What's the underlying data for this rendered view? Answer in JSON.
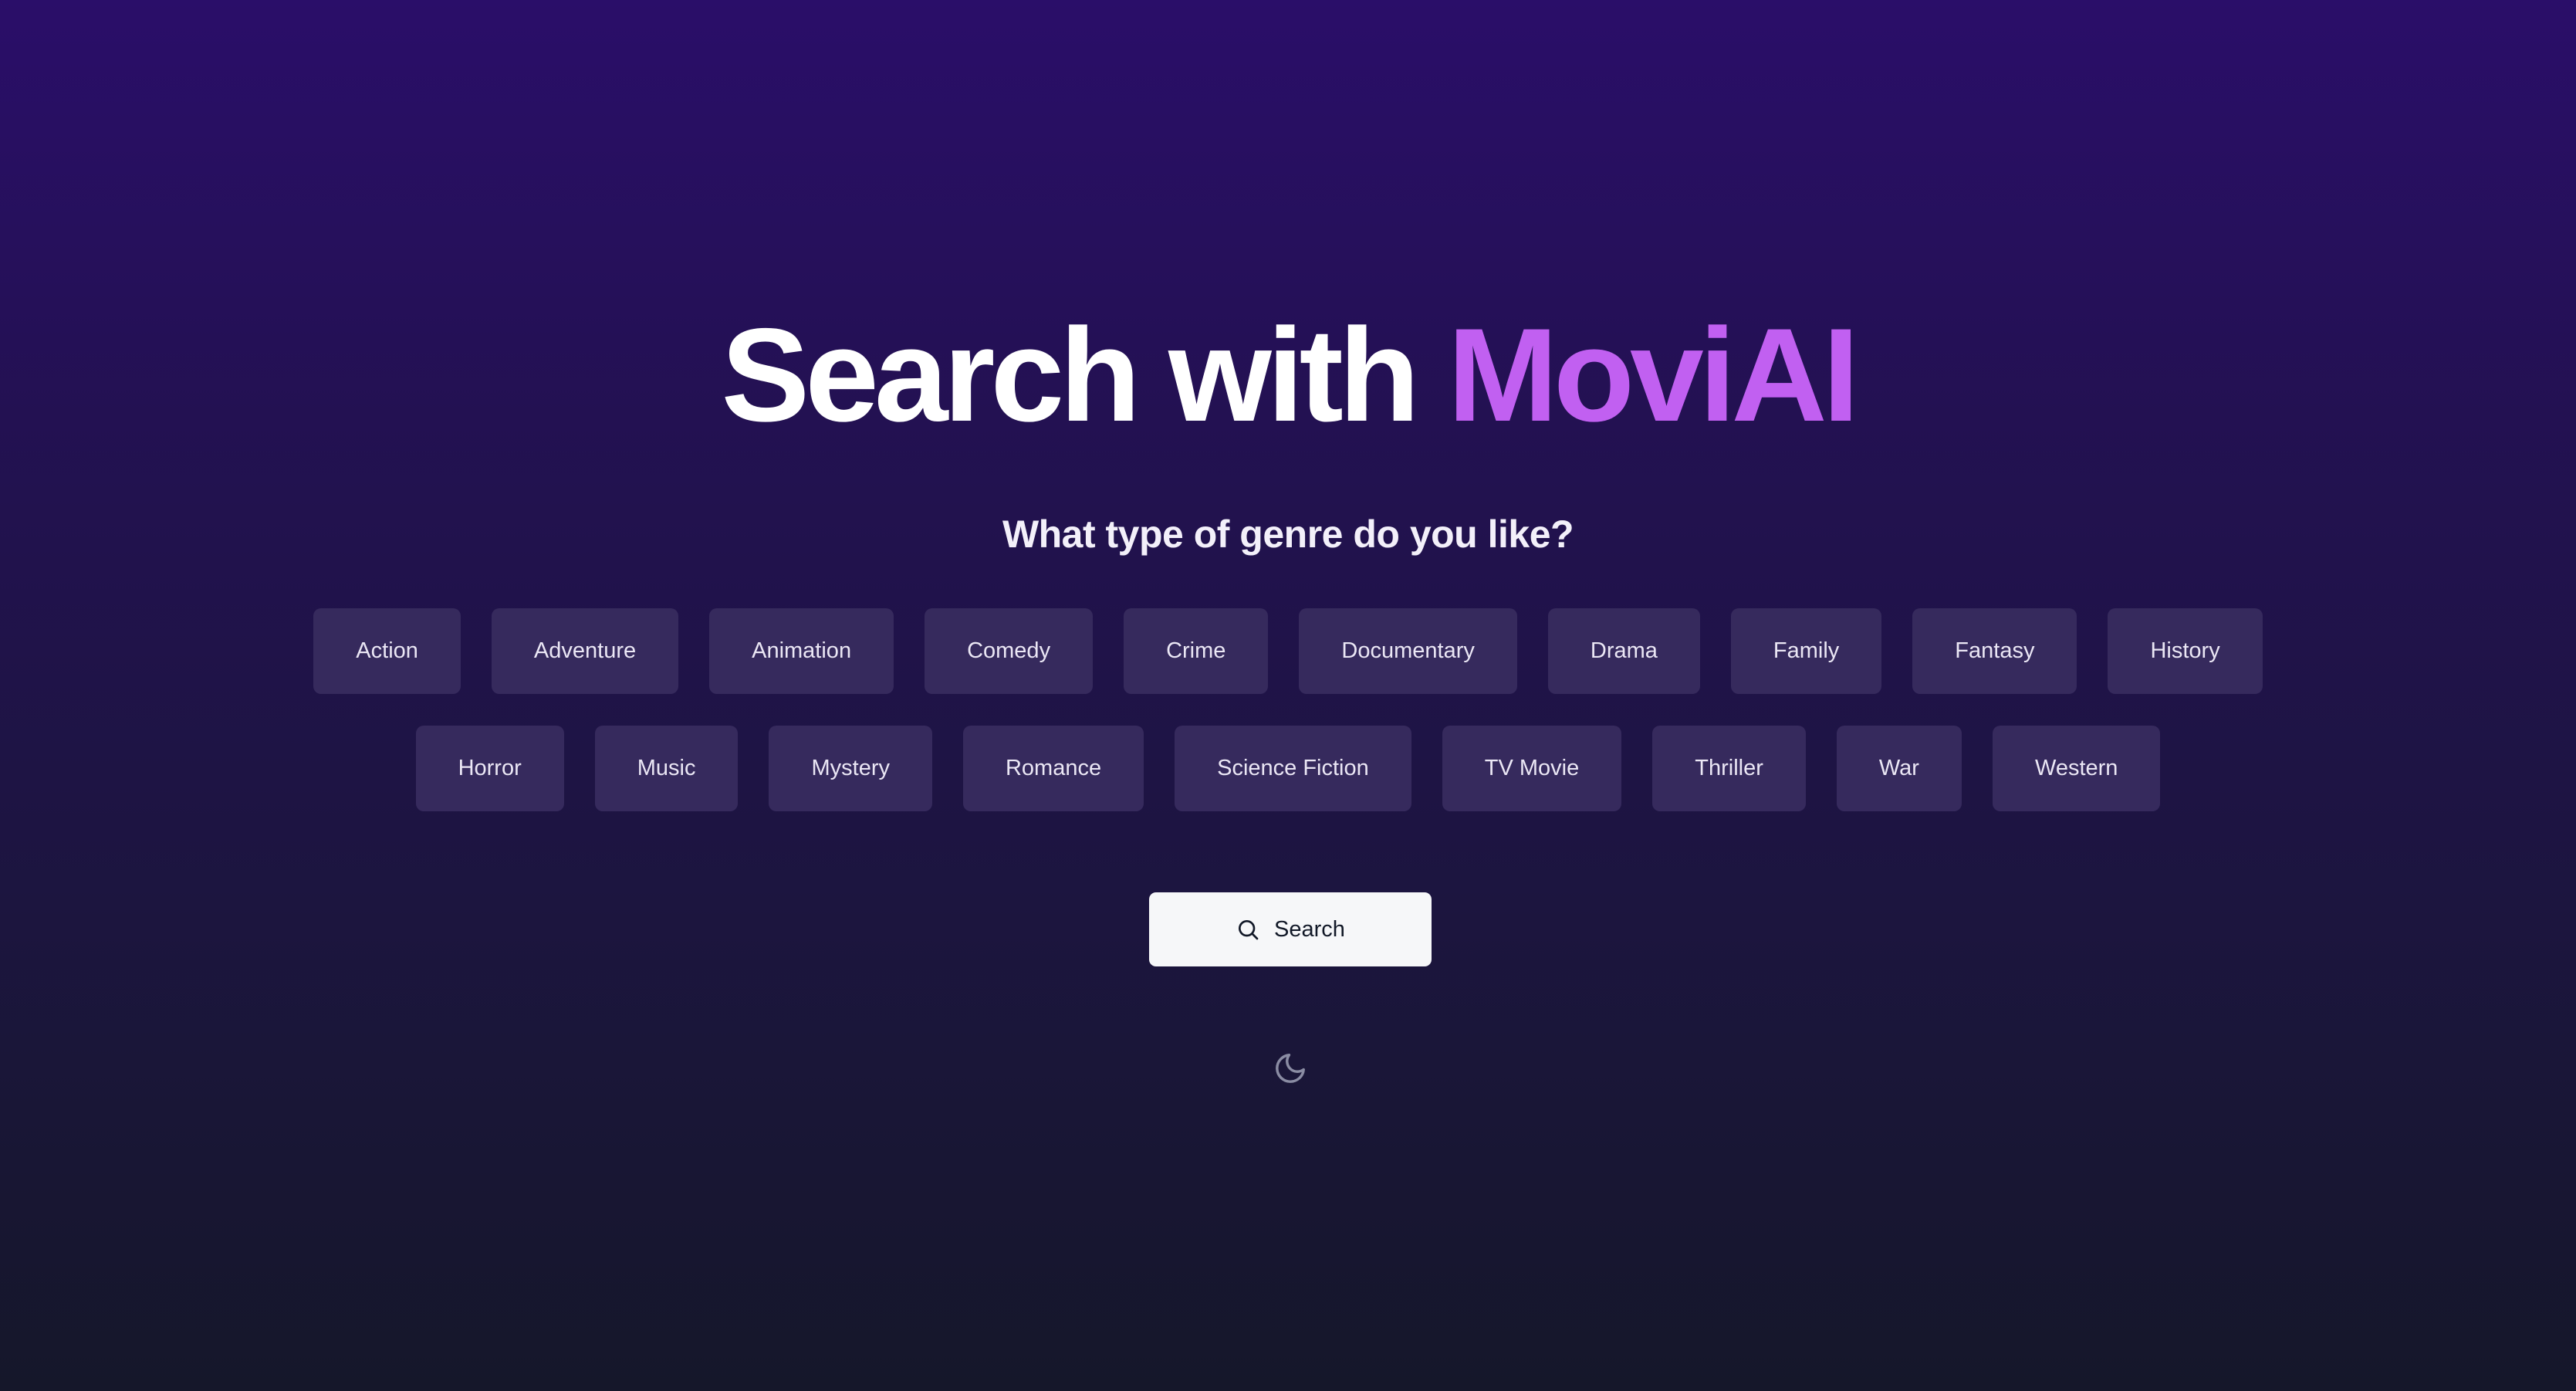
{
  "hero": {
    "title_prefix": "Search with",
    "title_brand": "MoviAI"
  },
  "subtitle": "What type of genre do you like?",
  "genres": {
    "row1": [
      "Action",
      "Adventure",
      "Animation",
      "Comedy",
      "Crime",
      "Documentary",
      "Drama",
      "Family",
      "Fantasy",
      "History"
    ],
    "row2": [
      "Horror",
      "Music",
      "Mystery",
      "Romance",
      "Science Fiction",
      "TV Movie",
      "Thriller",
      "War",
      "Western"
    ]
  },
  "search_button": {
    "label": "Search",
    "icon": "search-icon"
  },
  "theme_toggle": {
    "icon": "moon-icon"
  },
  "colors": {
    "brand_accent": "#c160f1",
    "chip_background": "#362a5d",
    "button_background": "#f6f7f9"
  }
}
